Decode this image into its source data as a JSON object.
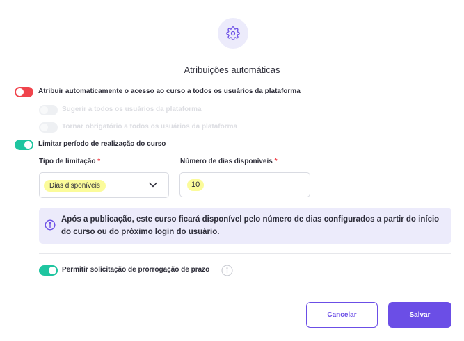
{
  "modal": {
    "icon": "gear-icon",
    "title": "Atribuições automáticas"
  },
  "toggles": {
    "auto_access": {
      "label": "Atribuir automaticamente o acesso ao curso a todos os usuários da plataforma",
      "state": "off"
    },
    "suggest_all": {
      "label": "Sugerir a todos os usuários da plataforma",
      "state": "disabled"
    },
    "make_mandatory": {
      "label": "Tornar obrigatório a todos os usuários da plataforma",
      "state": "disabled"
    },
    "limit_period": {
      "label": "Limitar período de realização do curso",
      "state": "on"
    },
    "allow_extension": {
      "label": "Permitir solicitação de prorrogação de prazo",
      "state": "on"
    }
  },
  "form": {
    "limit_type": {
      "label": "Tipo de limitação",
      "required_mark": "*",
      "value": "Dias disponíveis"
    },
    "days_available": {
      "label": "Número de dias disponíveis",
      "required_mark": "*",
      "value": "10"
    }
  },
  "info": {
    "icon": "info-icon",
    "text": "Após a publicação, este curso ficará disponível pelo número de dias configurados a partir do início do curso ou do próximo login do usuário."
  },
  "help_icon": "info-icon",
  "buttons": {
    "cancel": "Cancelar",
    "save": "Salvar"
  },
  "colors": {
    "accent": "#6b4ee6",
    "toggle_on": "#1fc5a0",
    "toggle_off_alert": "#f0444c",
    "info_bg": "#ecebfb",
    "highlight": "#fbfb9a"
  }
}
